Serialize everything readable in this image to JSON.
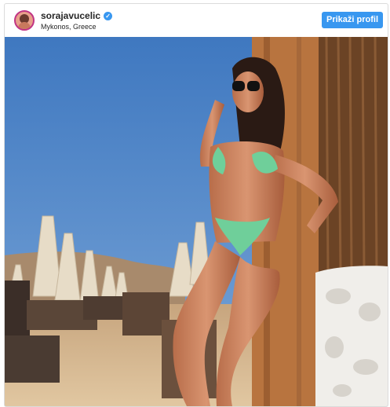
{
  "header": {
    "username": "sorajavucelic",
    "verified_icon": "verified-badge-icon",
    "location": "Mykonos, Greece",
    "profile_button_label": "Prikaži profil"
  },
  "post": {
    "image_kind": "beach photo",
    "colors": {
      "sky": "#4f86c6",
      "sand": "#d2b38f",
      "swimsuit": "#6fcf9a",
      "wall": "#f2f0ec"
    }
  },
  "colors": {
    "accent": "#3897f0",
    "border": "#dbdbdb",
    "text": "#262626"
  }
}
